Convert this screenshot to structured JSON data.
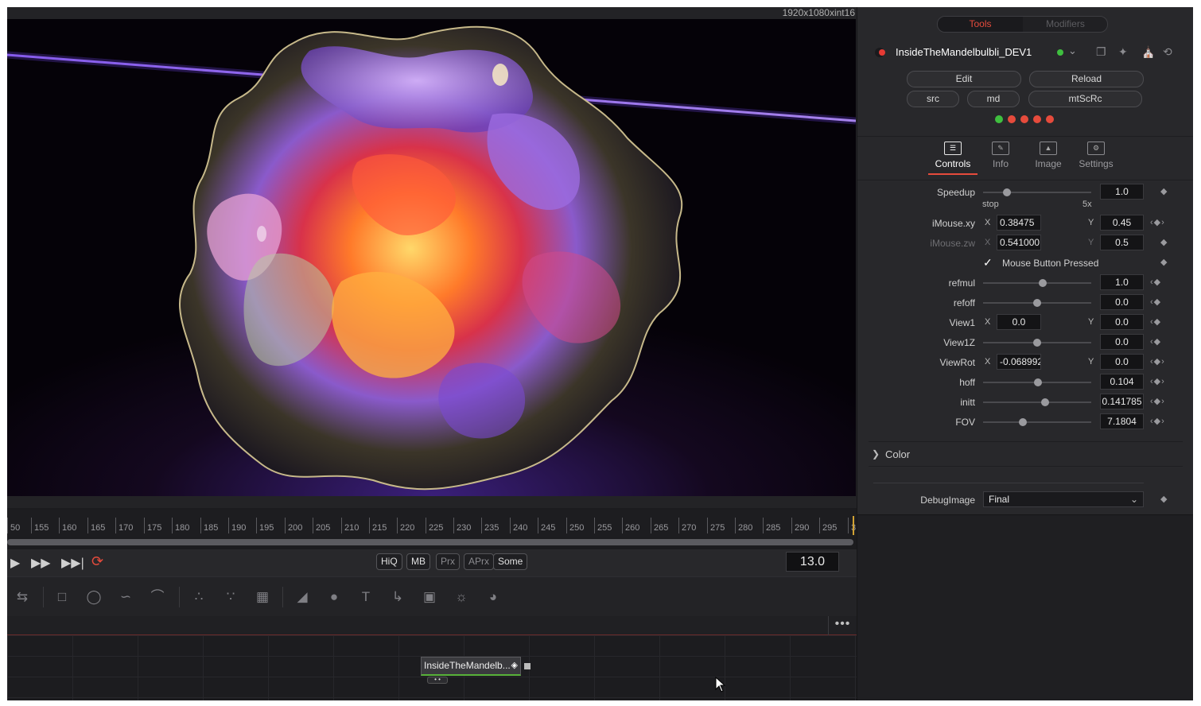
{
  "viewer": {
    "resolution": "1920x1080xint16"
  },
  "ruler": {
    "ticks": [
      "50",
      "155",
      "160",
      "165",
      "170",
      "175",
      "180",
      "185",
      "190",
      "195",
      "200",
      "205",
      "210",
      "215",
      "220",
      "225",
      "230",
      "235",
      "240",
      "245",
      "250",
      "255",
      "260",
      "265",
      "270",
      "275",
      "280",
      "285",
      "290",
      "295",
      "3"
    ]
  },
  "transport": {
    "play_icon": "play-icon",
    "forward_icon": "fast-forward-icon",
    "end_icon": "skip-to-end-icon",
    "loop_icon": "loop-icon",
    "hiq": "HiQ",
    "mb": "MB",
    "prx": "Prx",
    "aprx": "APrx",
    "some": "Some",
    "frame": "13.0"
  },
  "node": {
    "label": "InsideTheMandelb...",
    "status_color": "#58b23a"
  },
  "inspector": {
    "tabs": {
      "tools": "Tools",
      "modifiers": "Modifiers"
    },
    "tool_name": "InsideTheMandelbulbli_DEV1",
    "buttons": {
      "edit": "Edit",
      "reload": "Reload",
      "src": "src",
      "md": "md",
      "mtscrc": "mtScRc"
    },
    "status_dots": [
      "#3fbf3f",
      "#e64b3c",
      "#e64b3c",
      "#e64b3c",
      "#e64b3c"
    ],
    "sections": {
      "controls": "Controls",
      "info": "Info",
      "image": "Image",
      "settings": "Settings"
    },
    "controls": {
      "speedup": {
        "label": "Speedup",
        "value": "1.0",
        "min_label": "stop",
        "max_label": "5x",
        "level": 0.22
      },
      "imouse_xy": {
        "label": "iMouse.xy",
        "x": "0.38475",
        "y": "0.45"
      },
      "imouse_zw": {
        "label": "iMouse.zw",
        "x": "0.541000",
        "y": "0.5"
      },
      "mouse_button": {
        "label": "Mouse Button Pressed",
        "checked": true
      },
      "refmul": {
        "label": "refmul",
        "value": "1.0",
        "level": 0.55
      },
      "refoff": {
        "label": "refoff",
        "value": "0.0",
        "level": 0.5
      },
      "view1": {
        "label": "View1",
        "x": "0.0",
        "y": "0.0"
      },
      "view1z": {
        "label": "View1Z",
        "value": "0.0",
        "level": 0.5
      },
      "viewrot": {
        "label": "ViewRot",
        "x": "-0.068992",
        "y": "0.0"
      },
      "hoff": {
        "label": "hoff",
        "value": "0.104",
        "level": 0.51
      },
      "initt": {
        "label": "initt",
        "value": "0.141785",
        "level": 0.57
      },
      "fov": {
        "label": "FOV",
        "value": "7.1804",
        "level": 0.37
      }
    },
    "color_section": "Color",
    "debug_image": {
      "label": "DebugImage",
      "value": "Final"
    }
  },
  "colors": {
    "accent": "#e64b3c",
    "panel": "#28282b",
    "background": "#1c1c1f",
    "playhead": "#d2a233"
  }
}
